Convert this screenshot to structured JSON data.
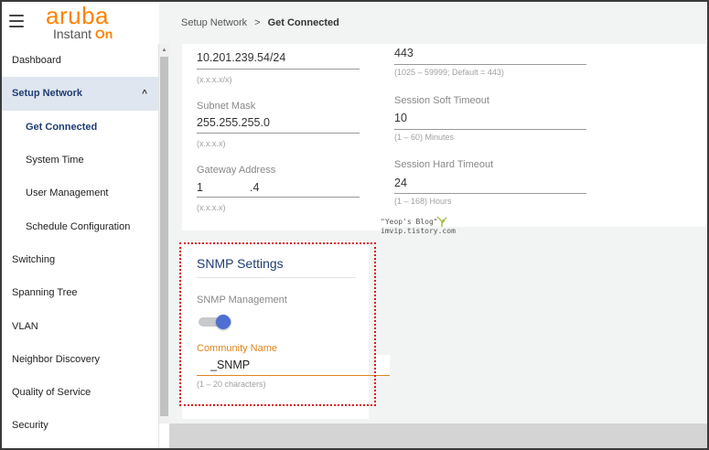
{
  "header": {
    "logo_word": "aruba",
    "logo_sub_prefix": "Instant ",
    "logo_sub_on": "On",
    "breadcrumb": {
      "parent": "Setup Network",
      "separator": ">",
      "current": "Get Connected"
    }
  },
  "sidebar": {
    "items": [
      {
        "label": "Dashboard"
      },
      {
        "label": "Setup Network",
        "chevron": "^"
      },
      {
        "label": "Get Connected"
      },
      {
        "label": "System Time"
      },
      {
        "label": "User Management"
      },
      {
        "label": "Schedule Configuration"
      },
      {
        "label": "Switching"
      },
      {
        "label": "Spanning Tree"
      },
      {
        "label": "VLAN"
      },
      {
        "label": "Neighbor Discovery"
      },
      {
        "label": "Quality of Service"
      },
      {
        "label": "Security"
      }
    ]
  },
  "ip_card": {
    "ip_value": "10.201.239.54/24",
    "ip_hint": "(x.x.x.x/x)",
    "subnet_label": "Subnet Mask",
    "subnet_value": "255.255.255.0",
    "subnet_hint": "(x.x.x.x)",
    "gateway_label": "Gateway Address",
    "gateway_value_a": "1",
    "gateway_value_b": ".4",
    "gateway_hint": "(x.x.x.x)"
  },
  "session_card": {
    "port_value": "443",
    "port_hint": "(1025 – 59999; Default = 443)",
    "soft_label": "Session Soft Timeout",
    "soft_value": "10",
    "soft_hint": "(1 – 60) Minutes",
    "hard_label": "Session Hard Timeout",
    "hard_value": "24",
    "hard_hint": "(1 – 168) Hours"
  },
  "snmp": {
    "title": "SNMP Settings",
    "management_label": "SNMP Management",
    "management_enabled": true,
    "community_label": "Community Name",
    "community_value": "_SNMP",
    "community_hint": "(1 – 20 characters)"
  },
  "watermark": {
    "line1": "\"Yeop's Blog\"",
    "line2": "imvip.tistory.com"
  },
  "colors": {
    "brand_orange": "#ff8300",
    "nav_active_bg": "#dfe6ef",
    "nav_active_text": "#1f3d73",
    "toggle_on": "#4d6fd1",
    "focus_orange": "#e0851b",
    "annotation_red": "#d81818"
  }
}
